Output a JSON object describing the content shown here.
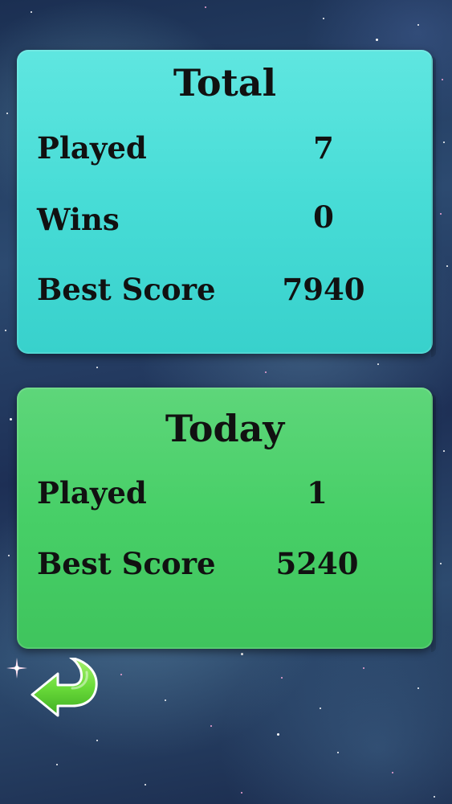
{
  "total": {
    "title": "Total",
    "rows": [
      {
        "label": "Played",
        "value": "7"
      },
      {
        "label": "Wins",
        "value": "0"
      },
      {
        "label": "Best Score",
        "value": "7940"
      }
    ]
  },
  "today": {
    "title": "Today",
    "rows": [
      {
        "label": "Played",
        "value": "1"
      },
      {
        "label": "Best Score",
        "value": "5240"
      }
    ]
  },
  "colors": {
    "total_panel": "#47dcd6",
    "today_panel": "#47cf67",
    "back_arrow": "#6bdc3a"
  },
  "icons": {
    "back": "back-arrow-icon",
    "sparkle": "sparkle-icon"
  }
}
